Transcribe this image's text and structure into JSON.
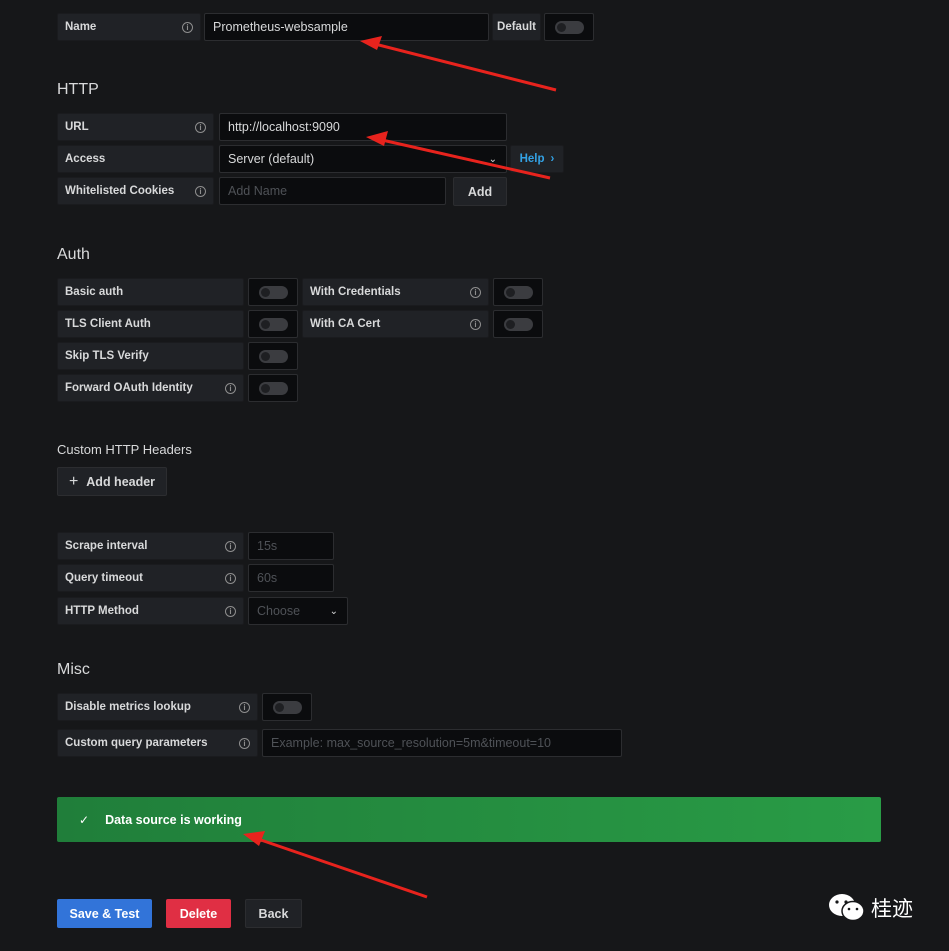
{
  "name_row": {
    "label": "Name",
    "value": "Prometheus-websample",
    "default_label": "Default"
  },
  "http": {
    "title": "HTTP",
    "url_label": "URL",
    "url_value": "http://localhost:9090",
    "access_label": "Access",
    "access_value": "Server (default)",
    "help_label": "Help",
    "cookies_label": "Whitelisted Cookies",
    "cookies_placeholder": "Add Name",
    "add_label": "Add"
  },
  "auth": {
    "title": "Auth",
    "basic_auth": "Basic auth",
    "with_credentials": "With Credentials",
    "tls_client_auth": "TLS Client Auth",
    "with_ca_cert": "With CA Cert",
    "skip_tls_verify": "Skip TLS Verify",
    "forward_oauth": "Forward OAuth Identity"
  },
  "headers": {
    "title": "Custom HTTP Headers",
    "add_header": "Add header"
  },
  "prom": {
    "scrape_label": "Scrape interval",
    "scrape_placeholder": "15s",
    "timeout_label": "Query timeout",
    "timeout_placeholder": "60s",
    "method_label": "HTTP Method",
    "method_placeholder": "Choose"
  },
  "misc": {
    "title": "Misc",
    "disable_metrics": "Disable metrics lookup",
    "custom_query_label": "Custom query parameters",
    "custom_query_placeholder": "Example: max_source_resolution=5m&timeout=10"
  },
  "status": {
    "message": "Data source is working"
  },
  "actions": {
    "save": "Save & Test",
    "delete": "Delete",
    "back": "Back"
  },
  "watermark": {
    "text": "桂迹"
  },
  "colors": {
    "success": "#299c46",
    "primary": "#3274d9",
    "danger": "#e02f44",
    "annotation_arrow": "#e8231d"
  }
}
